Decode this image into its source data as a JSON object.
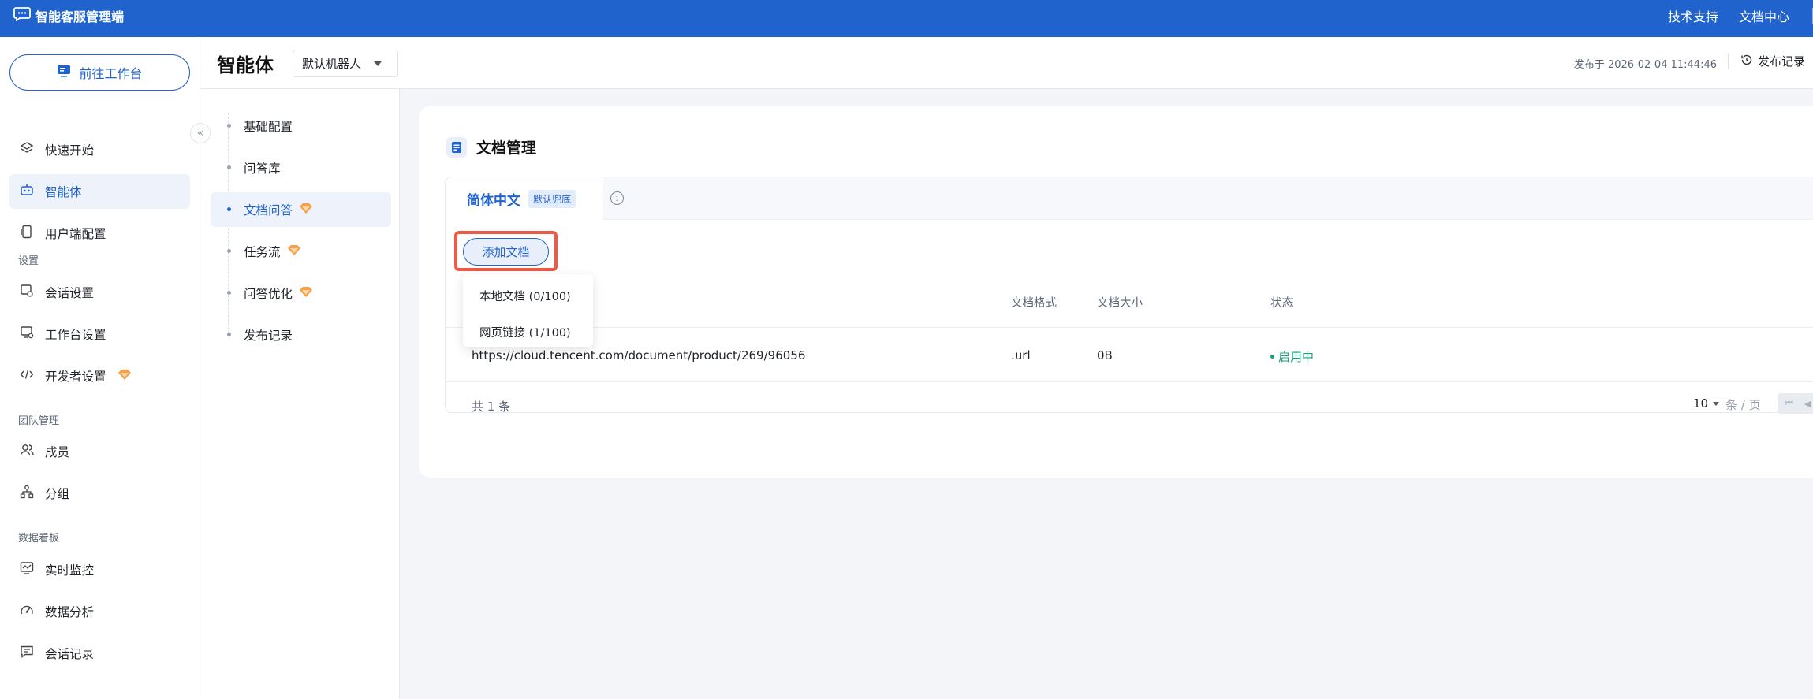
{
  "app": {
    "title": "智能客服管理端",
    "top_links": [
      "技术支持",
      "文档中心"
    ]
  },
  "sidebar": {
    "workbench_button": "前往工作台",
    "items": [
      {
        "label": "快速开始",
        "icon": "layers-icon"
      },
      {
        "label": "智能体",
        "icon": "robot-icon",
        "active": true
      },
      {
        "label": "用户端配置",
        "icon": "device-icon"
      }
    ],
    "sections": [
      {
        "title": "设置",
        "items": [
          {
            "label": "会话设置",
            "icon": "chat-settings-icon"
          },
          {
            "label": "工作台设置",
            "icon": "monitor-settings-icon"
          },
          {
            "label": "开发者设置",
            "icon": "code-icon",
            "premium": true
          }
        ]
      },
      {
        "title": "团队管理",
        "items": [
          {
            "label": "成员",
            "icon": "members-icon"
          },
          {
            "label": "分组",
            "icon": "org-tree-icon"
          }
        ]
      },
      {
        "title": "数据看板",
        "items": [
          {
            "label": "实时监控",
            "icon": "realtime-monitor-icon"
          },
          {
            "label": "数据分析",
            "icon": "gauge-icon"
          },
          {
            "label": "会话记录",
            "icon": "message-record-icon"
          }
        ]
      }
    ]
  },
  "header": {
    "page_title": "智能体",
    "bot_select": "默认机器人",
    "publish_time": "发布于 2026-02-04 11:44:46",
    "publish_record": "发布记录"
  },
  "submenu": {
    "items": [
      {
        "label": "基础配置"
      },
      {
        "label": "问答库"
      },
      {
        "label": "文档问答",
        "active": true,
        "premium": true
      },
      {
        "label": "任务流",
        "premium": true
      },
      {
        "label": "问答优化",
        "premium": true
      },
      {
        "label": "发布记录"
      }
    ]
  },
  "main": {
    "card_title": "文档管理",
    "lang_tab": "简体中文",
    "lang_badge": "默认兜底",
    "info_glyph": "i",
    "add_button": "添加文档",
    "dropdown": [
      "本地文档 (0/100)",
      "网页链接 (1/100)"
    ],
    "table": {
      "columns": [
        "文档格式",
        "文档大小",
        "状态"
      ],
      "rows": [
        {
          "name": "https://cloud.tencent.com/document/product/269/96056",
          "format": ".url",
          "size": "0B",
          "status": "启用中"
        }
      ]
    },
    "total": "共 1 条",
    "page_size": "10",
    "per_page": "条 / 页",
    "colors": {
      "brand": "#2063cc",
      "status_active": "#14a37f",
      "highlight": "#ef5a47",
      "premium": "#f4a14a"
    }
  }
}
